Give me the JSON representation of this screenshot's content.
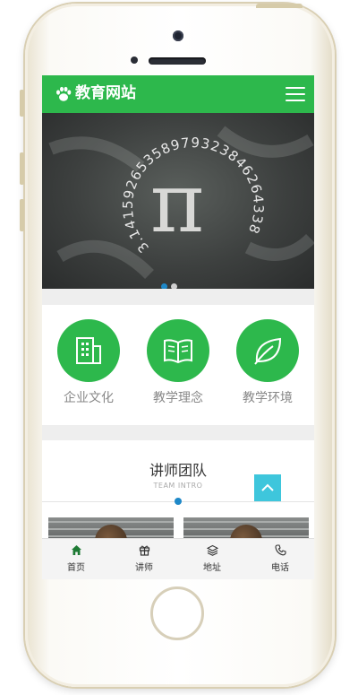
{
  "header": {
    "title": "教育网站",
    "logo_icon": "paw-icon",
    "menu_icon": "hamburger-icon",
    "bg_color": "#2db84c"
  },
  "banner": {
    "symbol": "π",
    "digits": "3.14159265358979323846264338",
    "slides": 2,
    "active_slide": 1
  },
  "features": [
    {
      "label": "企业文化",
      "icon": "building-icon"
    },
    {
      "label": "教学理念",
      "icon": "book-icon"
    },
    {
      "label": "教学环境",
      "icon": "leaf-icon"
    }
  ],
  "team": {
    "heading": "讲师团队",
    "subheading": "TEAM INTRO"
  },
  "tabbar": [
    {
      "label": "首页",
      "icon": "home-icon",
      "active": true
    },
    {
      "label": "讲师",
      "icon": "gift-icon",
      "active": false
    },
    {
      "label": "地址",
      "icon": "layers-icon",
      "active": false
    },
    {
      "label": "电话",
      "icon": "phone-icon",
      "active": false
    }
  ],
  "colors": {
    "accent": "#2db84c",
    "scroll_top": "#3ec6dc",
    "dot_active": "#1e88c8"
  }
}
